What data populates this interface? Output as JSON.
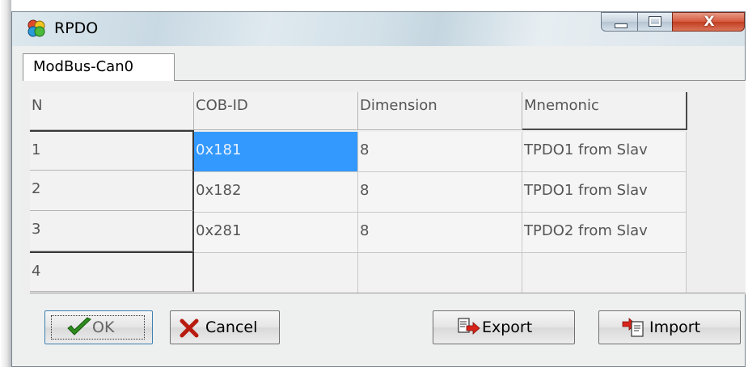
{
  "window": {
    "title": "RPDO",
    "close_glyph": "X"
  },
  "tabs": [
    {
      "label": "ModBus-Can0",
      "active": true
    }
  ],
  "grid": {
    "headers": [
      "N",
      "COB-ID",
      "Dimension",
      "Mnemonic"
    ],
    "rows": [
      {
        "n": "1",
        "cob_id": "0x181",
        "dimension": "8",
        "mnemonic": "TPDO1 from Slav"
      },
      {
        "n": "2",
        "cob_id": "0x182",
        "dimension": "8",
        "mnemonic": "TPDO1 from Slav"
      },
      {
        "n": "3",
        "cob_id": "0x281",
        "dimension": "8",
        "mnemonic": "TPDO2 from Slav"
      },
      {
        "n": "4",
        "cob_id": "",
        "dimension": "",
        "mnemonic": ""
      }
    ],
    "selected_cell": {
      "row": 1,
      "column": "COB-ID"
    }
  },
  "buttons": {
    "ok": "OK",
    "cancel": "Cancel",
    "export": "Export",
    "import": "Import"
  },
  "icons": {
    "app": "rpdo-app-icon",
    "ok": "checkmark-icon",
    "cancel": "red-x-icon",
    "export": "export-arrow-icon",
    "import": "import-arrow-icon"
  },
  "colors": {
    "selection": "#3399ff",
    "checkmark": "#2e8b1e",
    "cancel_x": "#b81c10",
    "arrow_red": "#d8241b"
  }
}
